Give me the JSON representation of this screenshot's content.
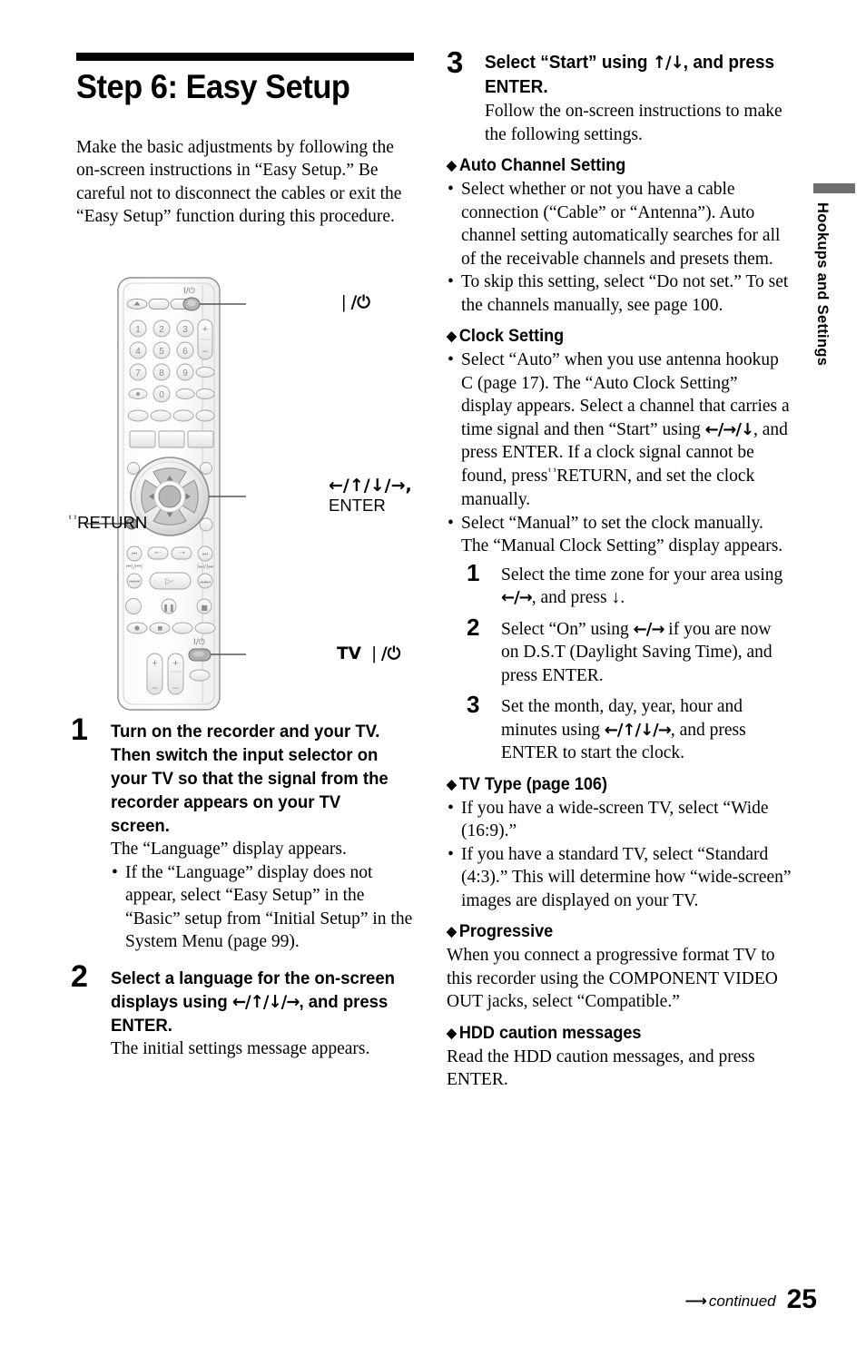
{
  "document": {
    "page_number": "25",
    "continued_label": "continued",
    "side_tab_label": "Hookups and Settings",
    "side_tab_color": "#6e6e6e"
  },
  "left": {
    "title": "Step 6: Easy Setup",
    "intro": "Make the basic adjustments by following the on-screen instructions in “Easy Setup.” Be careful not to disconnect the cables or exit the “Easy Setup” function during this procedure.",
    "figure": {
      "name": "remote-control-diagram",
      "callouts": [
        {
          "id": "power",
          "label": "❘/⏻"
        },
        {
          "id": "direction-enter",
          "label_line1": "←/↑/↓/→,",
          "label_line2": "ENTER"
        },
        {
          "id": "return",
          "icon": "᫅",
          "label": "RETURN"
        },
        {
          "id": "tv-power",
          "label": "TV ❘/⏻"
        }
      ]
    },
    "steps": [
      {
        "num": "1",
        "head": "Turn on the recorder and your TV. Then switch the input selector on your TV so that the signal from the recorder appears on your TV screen.",
        "body": "The “Language” display appears.",
        "bullets": [
          "If the “Language” display does not appear, select “Easy Setup” in the “Basic” setup from “Initial Setup” in the System Menu (page 99)."
        ]
      },
      {
        "num": "2",
        "head_pre": "Select a language for the on-screen displays using ",
        "head_arrows": "←/↑/↓/→",
        "head_post": ", and press ENTER.",
        "body": "The initial settings message appears."
      }
    ]
  },
  "right": {
    "step3": {
      "num": "3",
      "head_pre": "Select “Start” using ",
      "head_arrows": "↑/↓",
      "head_post": ", and press ENTER.",
      "body": "Follow the on-screen instructions to make the following settings."
    },
    "sections": [
      {
        "id": "auto-channel-setting",
        "heading": "Auto Channel Setting",
        "bullets": [
          "Select whether or not you have a cable connection (“Cable” or “Antenna”). Auto channel setting automatically searches for all of the receivable channels and presets them.",
          "To skip this setting, select “Do not set.” To set the channels manually, see page 100."
        ]
      },
      {
        "id": "clock-setting",
        "heading": "Clock Setting",
        "bullet1_a": "Select “Auto” when you use antenna hookup C (page 17). The “Auto Clock Setting” display appears.",
        "bullet1_b_pre": "Select a channel that carries a time signal and then “Start” using ",
        "bullet1_b_arrows": "←/→/↓",
        "bullet1_b_post": ", and press ENTER.",
        "bullet1_c_pre": "If a clock signal cannot be found, press ",
        "bullet1_c_icon": "᫅",
        "bullet1_c_post": " RETURN, and set the clock manually.",
        "bullet2": "Select “Manual” to set the clock manually. The “Manual Clock Setting” display appears.",
        "substeps": [
          {
            "num": "1",
            "pre": "Select the time zone for your area using ",
            "arrows": "←/→",
            "post": ", and press ↓."
          },
          {
            "num": "2",
            "pre": "Select “On” using ",
            "arrows": "←/→",
            "post": " if you are now on D.S.T (Daylight Saving Time), and press ENTER."
          },
          {
            "num": "3",
            "pre": "Set the month, day, year, hour and minutes using ",
            "arrows": "←/↑/↓/→",
            "post": ", and press ENTER to start the clock."
          }
        ]
      },
      {
        "id": "tv-type",
        "heading": "TV Type (page 106)",
        "bullets": [
          "If you have a wide-screen TV, select “Wide (16:9).”",
          "If you have a standard TV, select “Standard (4:3).” This will determine how “wide-screen” images are displayed on your TV."
        ]
      },
      {
        "id": "progressive",
        "heading": "Progressive",
        "paragraph": "When you connect a progressive format TV to this recorder using the COMPONENT VIDEO OUT jacks, select “Compatible.”"
      },
      {
        "id": "hdd-caution-messages",
        "heading": "HDD caution messages",
        "paragraph": "Read the HDD caution messages, and press ENTER."
      }
    ]
  }
}
